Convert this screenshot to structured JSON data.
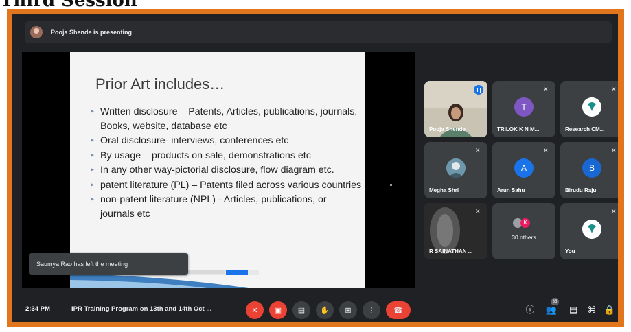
{
  "doc_heading": "Third Session",
  "presenting_bar": {
    "text": "Pooja Shende is presenting"
  },
  "slide": {
    "title": "Prior Art includes…",
    "bullets": [
      "Written disclosure – Patents, Articles, publications, journals, Books, website, database etc",
      "Oral disclosure- interviews, conferences etc",
      "By usage – products on sale, demonstrations etc",
      "In any other way-pictorial disclosure, flow diagram etc.",
      "patent literature (PL) – Patents filed across various countries",
      "non-patent literature (NPL) - Articles, publications, or journals etc"
    ]
  },
  "toast": "Saumya Rao has left the meeting",
  "participants": [
    {
      "name": "Pooja Shende",
      "type": "video"
    },
    {
      "name": "TRILOK K N M...",
      "initial": "T",
      "color": "#7e57c2"
    },
    {
      "name": "Research CM...",
      "type": "logo"
    },
    {
      "name": "Megha Shri",
      "type": "photo"
    },
    {
      "name": "Arun Sahu",
      "initial": "A",
      "color": "#1a73e8"
    },
    {
      "name": "Birudu Raju",
      "initial": "B",
      "color": "#1967d2"
    },
    {
      "name": "R SAINATHAN ...",
      "type": "video-dark"
    },
    {
      "name": "30 others",
      "initial": "K",
      "color": "#e91e63"
    },
    {
      "name": "You",
      "type": "logo"
    }
  ],
  "bottom_bar": {
    "time": "2:34 PM",
    "meeting_title": "IPR Training Program on 13th and 14th Oct ...",
    "people_count": "35"
  },
  "icons": [
    "mic-off-icon",
    "camera-off-icon",
    "captions-icon",
    "raise-hand-icon",
    "present-icon",
    "more-options-icon",
    "end-call-icon",
    "info-icon",
    "people-icon",
    "chat-icon",
    "activities-icon",
    "host-controls-icon"
  ]
}
